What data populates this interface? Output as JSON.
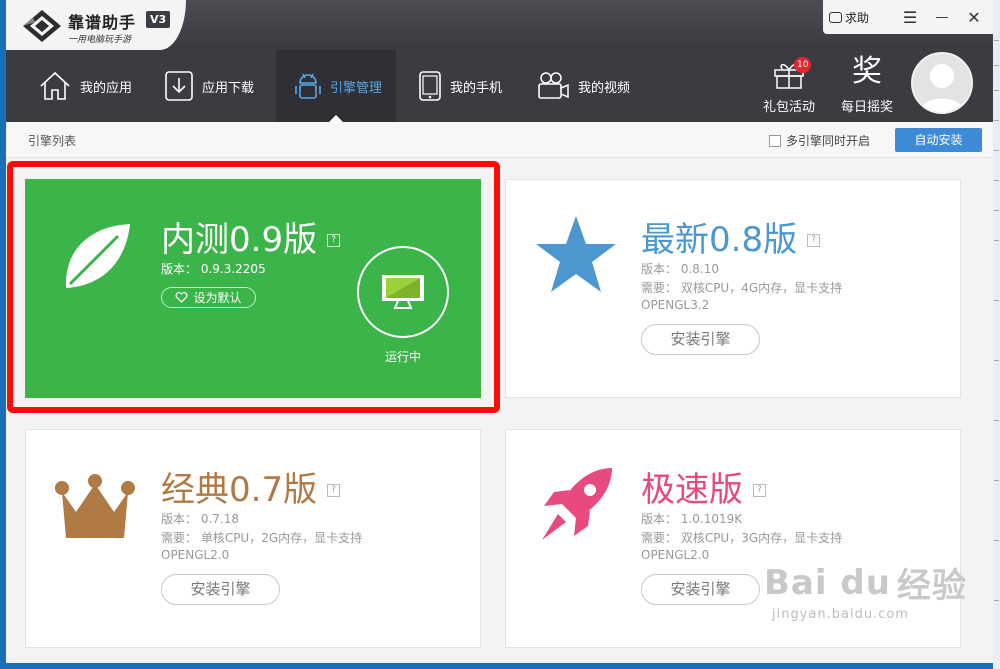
{
  "app": {
    "name": "靠谱助手",
    "version": "V3",
    "slogan": "一用电脑玩手游"
  },
  "window_controls": {
    "help": "求助",
    "menu": "☰",
    "minimize": "—",
    "close": "✕"
  },
  "nav": {
    "items": [
      {
        "label": "我的应用",
        "icon": "home-icon"
      },
      {
        "label": "应用下载",
        "icon": "download-icon"
      },
      {
        "label": "引擎管理",
        "icon": "android-icon",
        "active": true
      },
      {
        "label": "我的手机",
        "icon": "phone-icon"
      },
      {
        "label": "我的视频",
        "icon": "video-camera-icon"
      }
    ],
    "gift": {
      "label": "礼包活动",
      "badge": "10"
    },
    "shake": {
      "label": "每日摇奖",
      "glyph": "奖"
    }
  },
  "subbar": {
    "title": "引擎列表",
    "checkbox_label": "多引擎同时开启",
    "auto_install": "自动安装"
  },
  "engines": [
    {
      "title": "内测0.9版",
      "help": "?",
      "version": "版本： 0.9.3.2205",
      "set_default": "设为默认",
      "status": "运行中",
      "color": "#3bb54a",
      "icon": "leaf-icon"
    },
    {
      "title": "最新0.8版",
      "help": "?",
      "version": "版本： 0.8.10",
      "requirement": "需要： 双核CPU，4G内存，显卡支持",
      "requirement2": "OPENGL3.2",
      "install": "安装引擎",
      "color": "#4c97cf",
      "icon": "star-icon"
    },
    {
      "title": "经典0.7版",
      "help": "?",
      "version": "版本： 0.7.18",
      "requirement": "需要： 单核CPU，2G内存，显卡支持",
      "requirement2": "OPENGL2.0",
      "install": "安装引擎",
      "color": "#b07a44",
      "icon": "crown-icon"
    },
    {
      "title": "极速版",
      "help": "?",
      "version": "版本： 1.0.1019K",
      "requirement": "需要： 双核CPU，3G内存，显卡支持",
      "requirement2": "OPENGL2.0",
      "install": "安装引擎",
      "color": "#e84a80",
      "icon": "rocket-icon"
    }
  ],
  "watermark": {
    "brand": "Bai du",
    "cn": "经验",
    "url": "jingyan.baidu.com"
  }
}
